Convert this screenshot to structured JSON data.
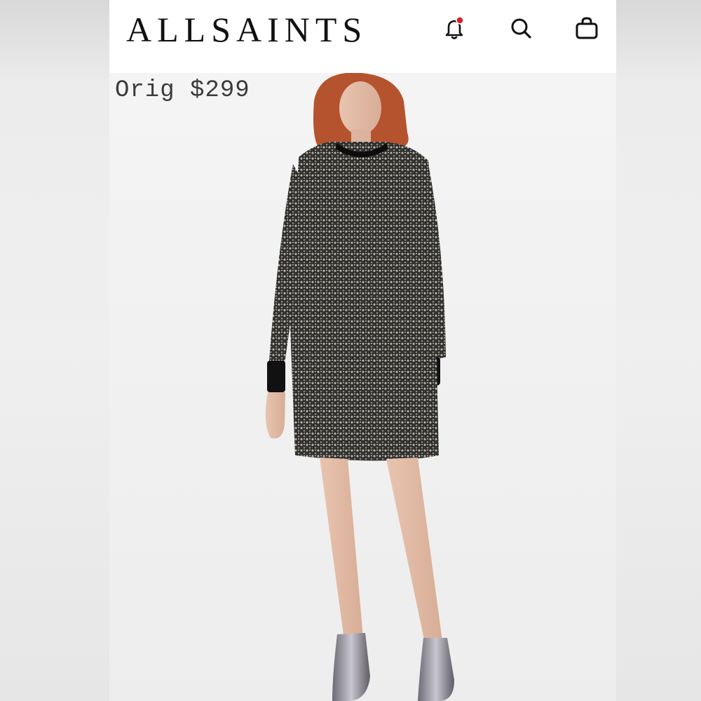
{
  "header": {
    "brand": "ALLSAINTS",
    "icons": [
      "bell-icon",
      "search-icon",
      "shopping-bag-icon"
    ],
    "notification_dot_color": "#d81f26"
  },
  "product": {
    "price_label": "Orig $299",
    "image": "model wearing long-sleeve sequin mini dress with ankle boots"
  }
}
